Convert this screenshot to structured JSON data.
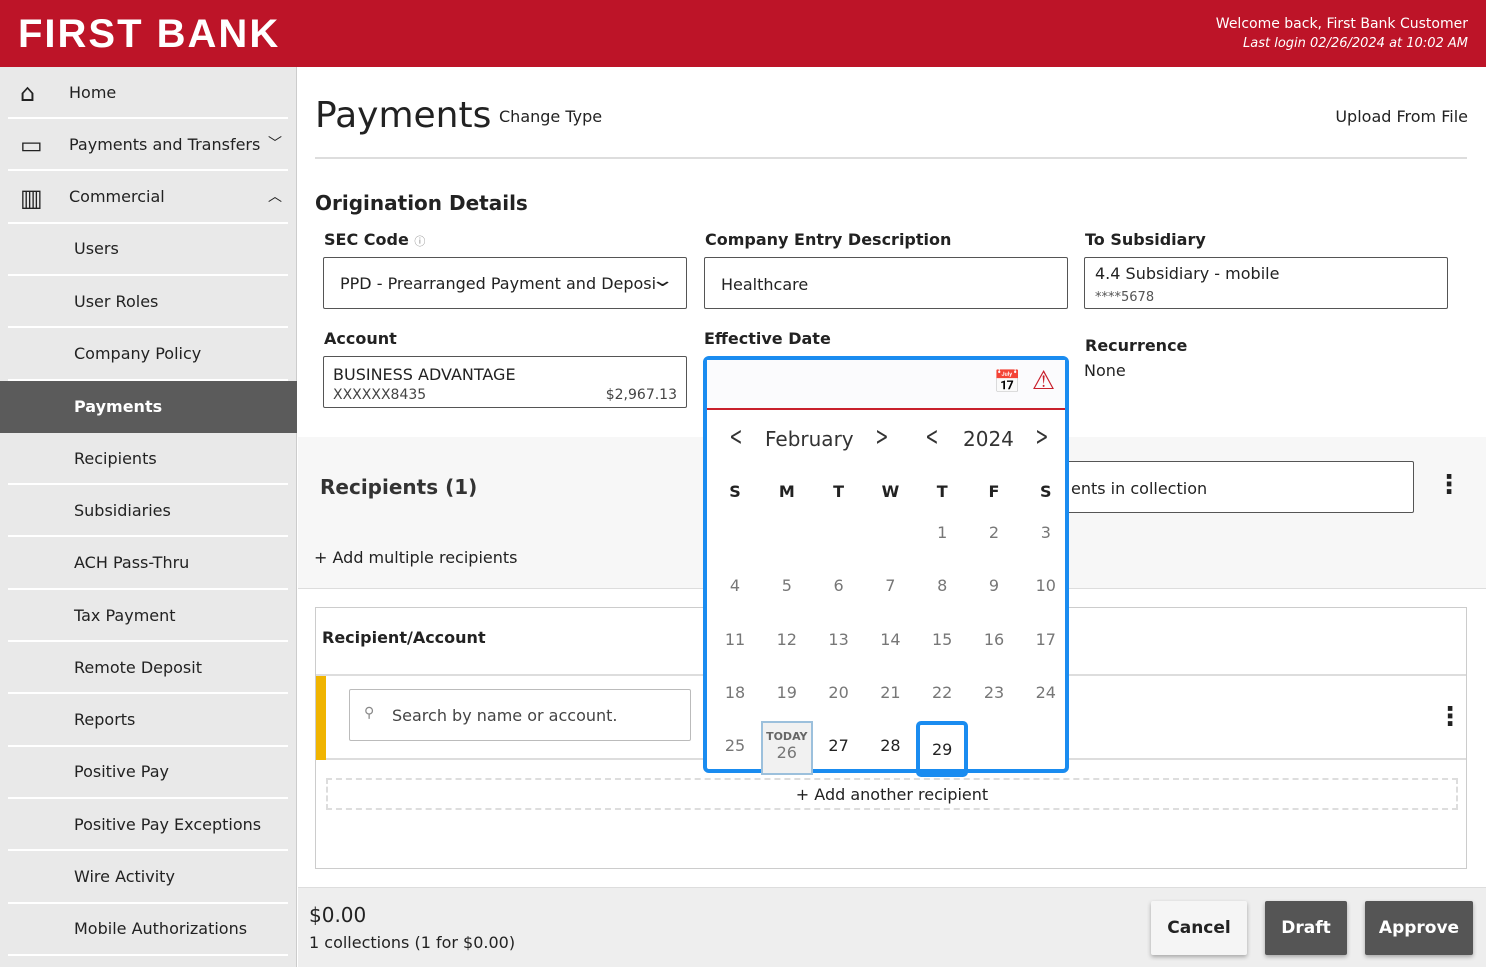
{
  "header": {
    "logo": "FIRST BANK",
    "welcome": "Welcome back, First Bank Customer",
    "last_login": "Last login 02/26/2024 at 10:02 AM",
    "brand_color": "#bd1428"
  },
  "sidebar": {
    "items": [
      {
        "label": "Home",
        "icon": "home-icon"
      },
      {
        "label": "Payments and Transfers",
        "icon": "card-icon",
        "chevron": "down"
      },
      {
        "label": "Commercial",
        "icon": "building-icon",
        "chevron": "up"
      },
      {
        "label": "Users"
      },
      {
        "label": "User Roles"
      },
      {
        "label": "Company Policy"
      },
      {
        "label": "Payments",
        "active": true
      },
      {
        "label": "Recipients"
      },
      {
        "label": "Subsidiaries"
      },
      {
        "label": "ACH Pass-Thru"
      },
      {
        "label": "Tax Payment"
      },
      {
        "label": "Remote Deposit"
      },
      {
        "label": "Reports"
      },
      {
        "label": "Positive Pay"
      },
      {
        "label": "Positive Pay Exceptions"
      },
      {
        "label": "Wire Activity"
      },
      {
        "label": "Mobile Authorizations"
      }
    ]
  },
  "page": {
    "title": "Payments",
    "change_type": "Change Type",
    "upload": "Upload From File"
  },
  "origination": {
    "heading": "Origination Details",
    "sec_code": {
      "label": "SEC Code",
      "value": "PPD - Prearranged Payment and Deposi"
    },
    "company_entry": {
      "label": "Company Entry Description",
      "value": "Healthcare"
    },
    "subsidiary": {
      "label": "To Subsidiary",
      "name": "4.4 Subsidiary - mobile",
      "number": "****5678"
    },
    "account": {
      "label": "Account",
      "name": "BUSINESS ADVANTAGE",
      "number": "XXXXXX8435",
      "balance": "$2,967.13"
    },
    "effective_date": {
      "label": "Effective Date",
      "value": ""
    },
    "recurrence": {
      "label": "Recurrence",
      "value": "None"
    }
  },
  "calendar": {
    "month": "February",
    "year": "2024",
    "dow": [
      "S",
      "M",
      "T",
      "W",
      "T",
      "F",
      "S"
    ],
    "today_label": "TODAY",
    "today": 26,
    "selected": 29,
    "first_dow": 4,
    "days": 29
  },
  "recipients": {
    "heading": "Recipients (1)",
    "add_multiple": "+ Add multiple recipients",
    "filter_value": "ents in collection",
    "column": "Recipient/Account",
    "search_placeholder": "Search by name or account.",
    "add_another": "+ Add another recipient"
  },
  "footer": {
    "total": "$0.00",
    "summary": "1 collections (1 for $0.00)",
    "cancel": "Cancel",
    "draft": "Draft",
    "approve": "Approve"
  }
}
